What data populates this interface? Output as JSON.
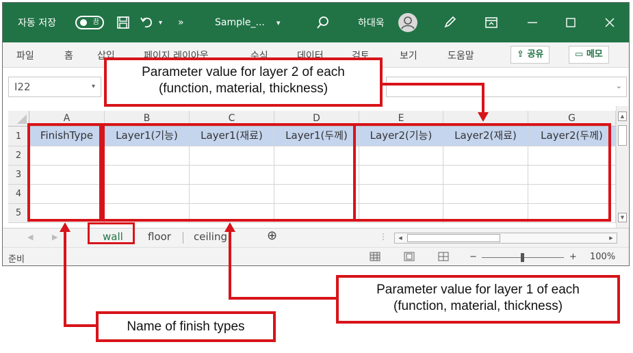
{
  "titlebar": {
    "autosave_label": "자동 저장",
    "autosave_state": "끔",
    "more": "»",
    "filename": "Sample_...",
    "filename_caret": "▾",
    "user": "하대욱",
    "icons": [
      "save-icon",
      "undo-icon",
      "search-icon",
      "user-avatar",
      "pen-icon",
      "ribbon-display-icon",
      "minimize-icon",
      "maximize-icon",
      "close-icon"
    ]
  },
  "ribbon": {
    "tabs": [
      "파일",
      "홈",
      "삽입",
      "페이지 레이아웃",
      "수식",
      "데이터",
      "검토",
      "보기",
      "도움말"
    ],
    "share": "공유",
    "comments": "메모"
  },
  "formula_bar": {
    "name_box": "I22"
  },
  "grid": {
    "columns": [
      "A",
      "B",
      "C",
      "D",
      "E",
      "F",
      "G"
    ],
    "rows": [
      "1",
      "2",
      "3",
      "4",
      "5"
    ],
    "header_cells": [
      "FinishType",
      "Layer1(기능)",
      "Layer1(재료)",
      "Layer1(두께)",
      "Layer2(기능)",
      "Layer2(재료)",
      "Layer2(두께)"
    ]
  },
  "sheets": {
    "tabs": [
      "wall",
      "floor",
      "ceiling"
    ],
    "active": "wall",
    "add": "⊕"
  },
  "status": {
    "ready": "준비",
    "zoom": "100%",
    "zoom_minus": "−",
    "zoom_plus": "+"
  },
  "annotations": {
    "layer2_line1": "Parameter value for layer 2 of each",
    "layer2_line2": "(function,  material,  thickness)",
    "layer1_line1": "Parameter value for layer 1 of each",
    "layer1_line2": "(function,  material,  thickness)",
    "finish_types": "Name of  finish types"
  },
  "colors": {
    "accent": "#217346",
    "annotation": "#d7141a",
    "header_fill": "#c5d5ee"
  }
}
